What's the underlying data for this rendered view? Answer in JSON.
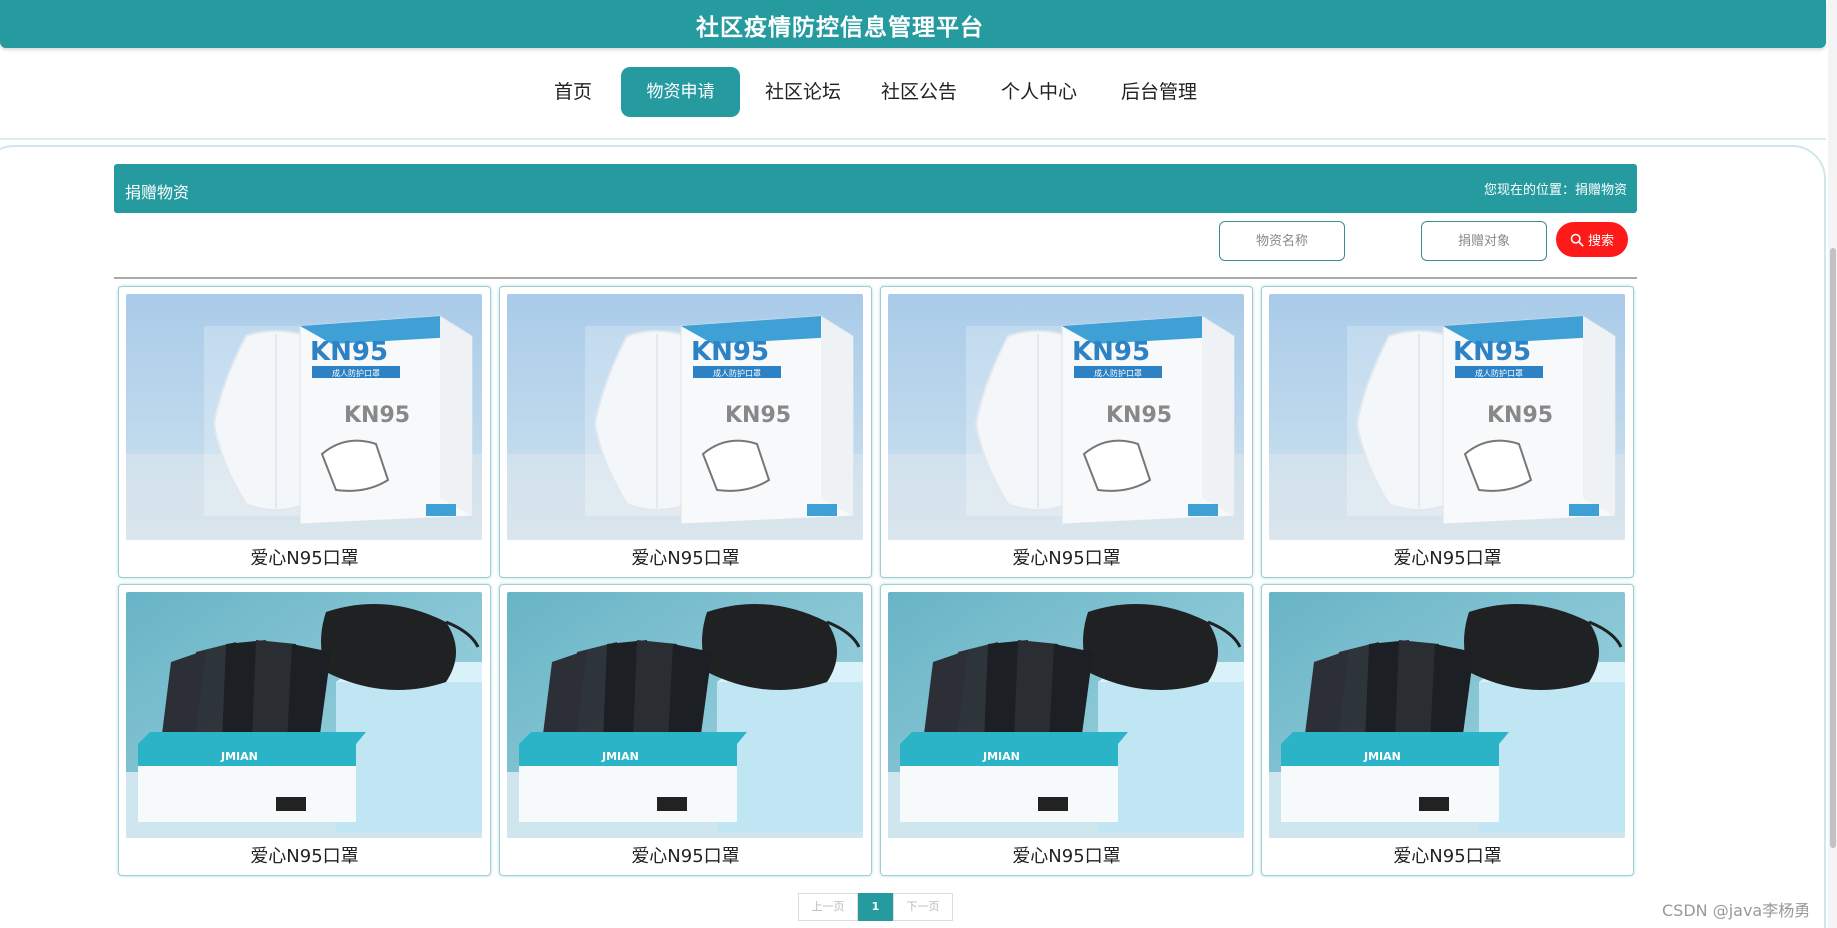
{
  "header": {
    "title": "社区疫情防控信息管理平台"
  },
  "nav": {
    "items": [
      {
        "label": "首页"
      },
      {
        "label": "物资申请"
      },
      {
        "label": "社区论坛"
      },
      {
        "label": "社区公告"
      },
      {
        "label": "个人中心"
      },
      {
        "label": "后台管理"
      }
    ],
    "active_index": 1
  },
  "section": {
    "title": "捐赠物资",
    "breadcrumb": "您现在的位置：捐赠物资"
  },
  "search": {
    "name_placeholder": "物资名称",
    "target_placeholder": "捐赠对象",
    "button_label": "搜索"
  },
  "products": [
    {
      "name": "爱心N95口罩",
      "image": "kn95-white-mask-box",
      "box_text": "KN95",
      "sub_text": "成人防护口罩"
    },
    {
      "name": "爱心N95口罩",
      "image": "kn95-white-mask-box",
      "box_text": "KN95",
      "sub_text": "成人防护口罩"
    },
    {
      "name": "爱心N95口罩",
      "image": "kn95-white-mask-box",
      "box_text": "KN95",
      "sub_text": "成人防护口罩"
    },
    {
      "name": "爱心N95口罩",
      "image": "kn95-white-mask-box",
      "box_text": "KN95",
      "sub_text": "成人防护口罩"
    },
    {
      "name": "爱心N95口罩",
      "image": "black-surgical-mask-box",
      "box_text": "JMIAN"
    },
    {
      "name": "爱心N95口罩",
      "image": "black-surgical-mask-box",
      "box_text": "JMIAN"
    },
    {
      "name": "爱心N95口罩",
      "image": "black-surgical-mask-box",
      "box_text": "JMIAN"
    },
    {
      "name": "爱心N95口罩",
      "image": "black-surgical-mask-box",
      "box_text": "JMIAN"
    }
  ],
  "pagination": {
    "prev_label": "上一页",
    "current_page": "1",
    "next_label": "下一页"
  },
  "watermark": "CSDN @java李杨勇",
  "colors": {
    "primary": "#259b9f",
    "search_button": "#ff1a1a"
  },
  "icons": {
    "search_button_icon": "search-icon"
  }
}
